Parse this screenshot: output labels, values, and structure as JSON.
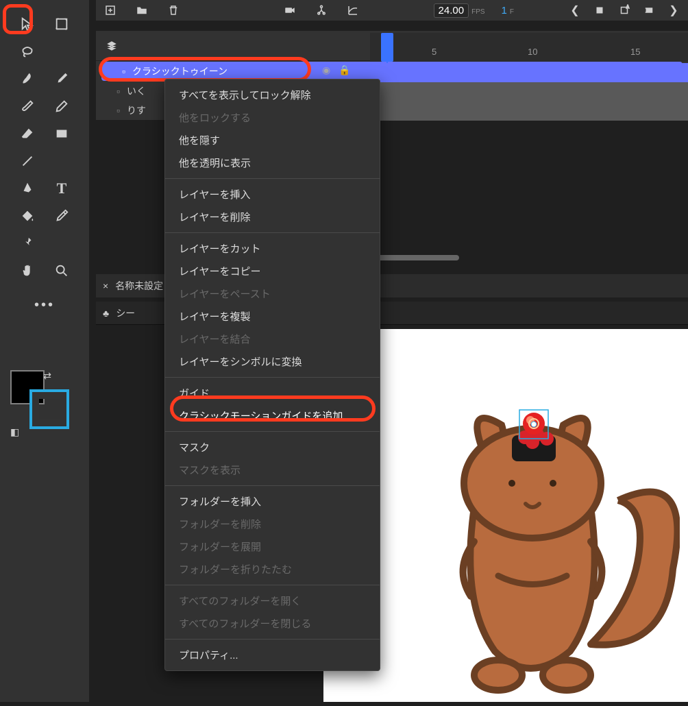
{
  "fps": {
    "value": "24.00",
    "label": "FPS",
    "frame": "1",
    "frame_label": "F"
  },
  "tab": {
    "close": "×",
    "title": "名称未設定"
  },
  "scene": {
    "title": "シー"
  },
  "ruler": [
    "5",
    "10",
    "15"
  ],
  "layers": [
    {
      "name": "クラシックトゥイーン"
    },
    {
      "name": "いく"
    },
    {
      "name": "りす"
    }
  ],
  "context_menu": [
    {
      "t": "すべてを表示してロック解除"
    },
    {
      "t": "他をロックする",
      "d": true
    },
    {
      "t": "他を隠す"
    },
    {
      "t": "他を透明に表示"
    },
    {
      "sep": true
    },
    {
      "t": "レイヤーを挿入"
    },
    {
      "t": "レイヤーを削除"
    },
    {
      "sep": true
    },
    {
      "t": "レイヤーをカット"
    },
    {
      "t": "レイヤーをコピー"
    },
    {
      "t": "レイヤーをペースト",
      "d": true
    },
    {
      "t": "レイヤーを複製"
    },
    {
      "t": "レイヤーを結合",
      "d": true
    },
    {
      "t": "レイヤーをシンボルに変換"
    },
    {
      "sep": true
    },
    {
      "t": "ガイド"
    },
    {
      "t": "クラシックモーションガイドを追加",
      "hl": true
    },
    {
      "sep": true
    },
    {
      "t": "マスク"
    },
    {
      "t": "マスクを表示",
      "d": true
    },
    {
      "sep": true
    },
    {
      "t": "フォルダーを挿入"
    },
    {
      "t": "フォルダーを削除",
      "d": true
    },
    {
      "t": "フォルダーを展開",
      "d": true
    },
    {
      "t": "フォルダーを折りたたむ",
      "d": true
    },
    {
      "sep": true
    },
    {
      "t": "すべてのフォルダーを開く",
      "d": true
    },
    {
      "t": "すべてのフォルダーを閉じる",
      "d": true
    },
    {
      "sep": true
    },
    {
      "t": "プロパティ..."
    }
  ],
  "colors": {
    "accent_blue": "#3a73ff",
    "annot_red": "#ff3b1f",
    "swatch_blue": "#29abe2"
  },
  "tool_more": "•••"
}
